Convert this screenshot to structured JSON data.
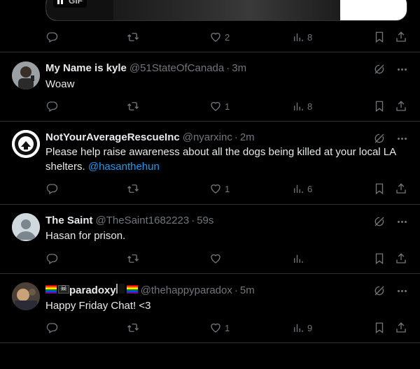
{
  "top": {
    "gif_label": "GIF",
    "actions": {
      "likes": "2",
      "views": "8"
    }
  },
  "tweets": [
    {
      "name": "My Name is kyle",
      "handle": "@51StateOfCanada",
      "time": "3m",
      "text": "Woaw",
      "mention": "",
      "likes": "1",
      "views": "8"
    },
    {
      "name": "NotYourAverageRescueInc",
      "handle": "@nyarxinc",
      "time": "2m",
      "text": "Please help raise awareness about all the dogs being killed at your local LA shelters. ",
      "mention": "@hasanthehun",
      "likes": "1",
      "views": "6"
    },
    {
      "name": "The Saint",
      "handle": "@TheSaint1682223",
      "time": "59s",
      "text": "Hasan for prison.",
      "mention": "",
      "likes": "",
      "views": ""
    },
    {
      "name": "paradoxy",
      "handle": "@thehappyparadox",
      "time": "5m",
      "text": "Happy Friday Chat! <3",
      "mention": "",
      "likes": "1",
      "views": "9"
    }
  ],
  "icons": {
    "reply": "reply-icon",
    "retweet": "retweet-icon",
    "like": "heart-icon",
    "views": "views-icon",
    "bookmark": "bookmark-icon",
    "share": "share-icon",
    "grok": "grok-icon",
    "more": "more-icon"
  },
  "colors": {
    "background": "#000000",
    "text": "#e7e9ea",
    "muted": "#71767b",
    "link": "#1d9bf0",
    "border": "#2f3336"
  }
}
